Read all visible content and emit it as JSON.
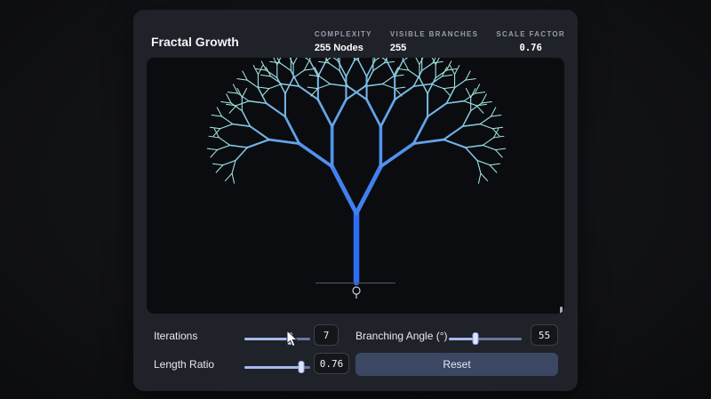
{
  "header": {
    "title": "Fractal Growth",
    "stats": [
      {
        "label": "COMPLEXITY",
        "value": "255 Nodes"
      },
      {
        "label": "VISIBLE BRANCHES",
        "value": "255"
      },
      {
        "label": "SCALE FACTOR",
        "value": "0.76"
      }
    ]
  },
  "tree": {
    "iterations": 7,
    "branching_angle_deg": 55,
    "length_ratio": 0.76,
    "node_count": 255,
    "trunk_color": "#2e6ef2",
    "tip_color": "#a9ecdf"
  },
  "controls": {
    "iterations": {
      "label": "Iterations",
      "value": "7",
      "percent": 69
    },
    "branching_angle": {
      "label": "Branching Angle (°)",
      "value": "55",
      "percent": 37
    },
    "length_ratio": {
      "label": "Length Ratio",
      "value": "0.76",
      "percent": 86
    },
    "reset_label": "Reset"
  }
}
